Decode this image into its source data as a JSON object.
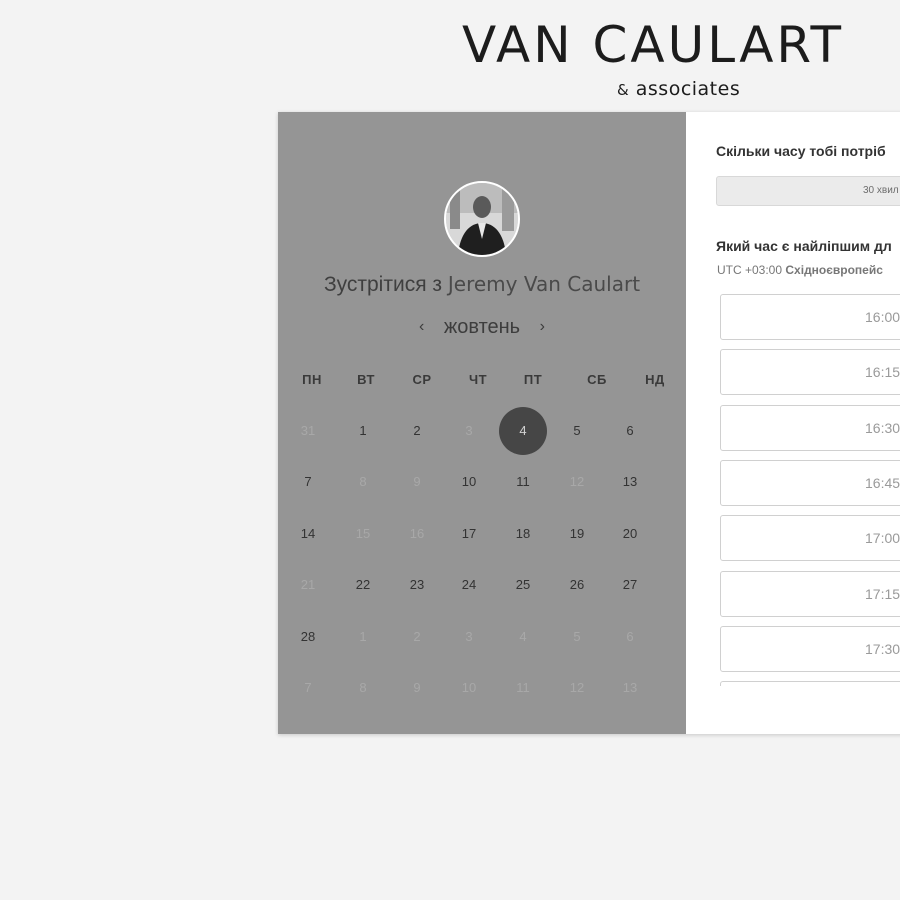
{
  "brand": {
    "name": "VAN CAULART",
    "sub_amp": "&",
    "sub_text": "associates"
  },
  "calendar": {
    "title_prefix": "Зустрітися з",
    "person": "Jeremy Van Caulart",
    "month": "жовтень",
    "prev_icon": "chevron-left-icon",
    "next_icon": "chevron-right-icon",
    "weekdays": [
      "ПН",
      "ВТ",
      "СР",
      "ЧТ",
      "ПТ",
      "СБ",
      "НД"
    ],
    "weeks": [
      [
        {
          "d": "31",
          "m": true
        },
        {
          "d": "1",
          "m": false
        },
        {
          "d": "2",
          "m": false
        },
        {
          "d": "3",
          "m": true
        },
        {
          "d": "4",
          "m": false,
          "s": true
        },
        {
          "d": "5",
          "m": false
        },
        {
          "d": "6",
          "m": false
        }
      ],
      [
        {
          "d": "7",
          "m": false
        },
        {
          "d": "8",
          "m": true
        },
        {
          "d": "9",
          "m": true
        },
        {
          "d": "10",
          "m": false
        },
        {
          "d": "11",
          "m": false
        },
        {
          "d": "12",
          "m": true
        },
        {
          "d": "13",
          "m": false
        }
      ],
      [
        {
          "d": "14",
          "m": false
        },
        {
          "d": "15",
          "m": true
        },
        {
          "d": "16",
          "m": true
        },
        {
          "d": "17",
          "m": false
        },
        {
          "d": "18",
          "m": false
        },
        {
          "d": "19",
          "m": false
        },
        {
          "d": "20",
          "m": false
        }
      ],
      [
        {
          "d": "21",
          "m": true
        },
        {
          "d": "22",
          "m": false
        },
        {
          "d": "23",
          "m": false
        },
        {
          "d": "24",
          "m": false
        },
        {
          "d": "25",
          "m": false
        },
        {
          "d": "26",
          "m": false
        },
        {
          "d": "27",
          "m": false
        }
      ],
      [
        {
          "d": "28",
          "m": false
        },
        {
          "d": "1",
          "m": true
        },
        {
          "d": "2",
          "m": true
        },
        {
          "d": "3",
          "m": true
        },
        {
          "d": "4",
          "m": true
        },
        {
          "d": "5",
          "m": true
        },
        {
          "d": "6",
          "m": true
        }
      ],
      [
        {
          "d": "7",
          "m": true
        },
        {
          "d": "8",
          "m": true
        },
        {
          "d": "9",
          "m": true
        },
        {
          "d": "10",
          "m": true
        },
        {
          "d": "11",
          "m": true
        },
        {
          "d": "12",
          "m": true
        },
        {
          "d": "13",
          "m": true
        }
      ]
    ],
    "selected_day": "4",
    "colors": {
      "panel": "#959595",
      "selected": "#464646"
    }
  },
  "booking": {
    "duration_label": "Скільки часу тобі потріб",
    "duration_value": "30 хвил",
    "time_label": "Який час є найліпшим дл",
    "tz_offset": "UTC +03:00",
    "tz_name": "Східноєвропейс",
    "slots": [
      "16:00",
      "16:15",
      "16:30",
      "16:45",
      "17:00",
      "17:15",
      "17:30",
      ""
    ]
  }
}
